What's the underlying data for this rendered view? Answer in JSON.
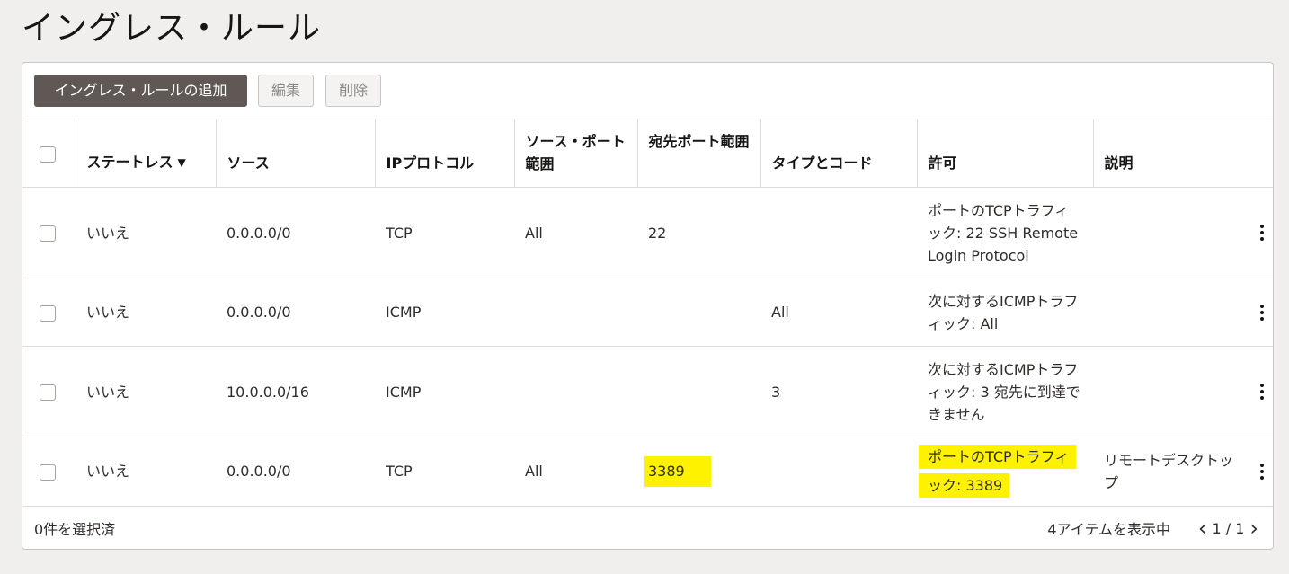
{
  "page": {
    "title": "イングレス・ルール"
  },
  "toolbar": {
    "add_label": "イングレス・ルールの追加",
    "edit_label": "編集",
    "delete_label": "削除"
  },
  "table": {
    "headers": {
      "stateless": "ステートレス",
      "source": "ソース",
      "ip_protocol": "IPプロトコル",
      "source_port": "ソース・ポート範囲",
      "dest_port": "宛先ポート範囲",
      "type_code": "タイプとコード",
      "allows": "許可",
      "description": "説明"
    },
    "rows": [
      {
        "stateless": "いいえ",
        "source": "0.0.0.0/0",
        "protocol": "TCP",
        "source_port": "All",
        "dest_port": "22",
        "type_code": "",
        "allows": "ポートのTCPトラフィック: 22 SSH Remote Login Protocol",
        "description": ""
      },
      {
        "stateless": "いいえ",
        "source": "0.0.0.0/0",
        "protocol": "ICMP",
        "source_port": "",
        "dest_port": "",
        "type_code": "All",
        "allows": "次に対するICMPトラフィック: All",
        "description": ""
      },
      {
        "stateless": "いいえ",
        "source": "10.0.0.0/16",
        "protocol": "ICMP",
        "source_port": "",
        "dest_port": "",
        "type_code": "3",
        "allows": "次に対するICMPトラフィック: 3 宛先に到達できません",
        "description": ""
      },
      {
        "stateless": "いいえ",
        "source": "0.0.0.0/0",
        "protocol": "TCP",
        "source_port": "All",
        "dest_port": "3389",
        "type_code": "",
        "allows": "ポートのTCPトラフィック: 3389",
        "description": "リモートデスクトップ"
      }
    ]
  },
  "footer": {
    "selected": "0件を選択済",
    "showing": "4アイテムを表示中",
    "pages": "1 / 1"
  },
  "colors": {
    "highlight": "#fff200",
    "primary_button": "#5f5854"
  }
}
